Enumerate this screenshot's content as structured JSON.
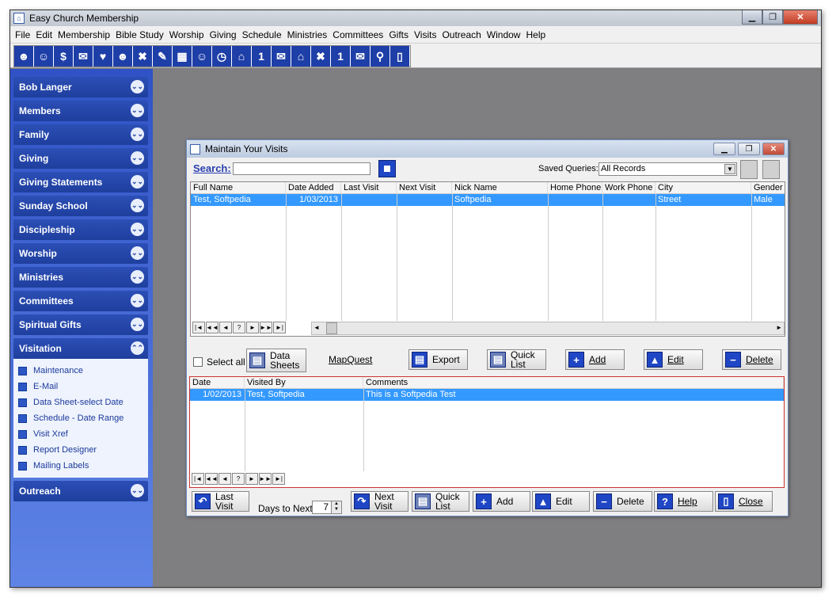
{
  "app": {
    "title": "Easy Church Membership"
  },
  "menu": [
    "File",
    "Edit",
    "Membership",
    "Bible Study",
    "Worship",
    "Giving",
    "Schedule",
    "Ministries",
    "Committees",
    "Gifts",
    "Visits",
    "Outreach",
    "Window",
    "Help"
  ],
  "toolbar_icons": [
    "people-icon",
    "person-icon",
    "dollar-icon",
    "envelope-icon",
    "heart-icon",
    "group-icon",
    "tools-icon",
    "pen-icon",
    "calendar-icon",
    "person-calendar-icon",
    "clock-calendar-icon",
    "house-icon",
    "number-one-icon",
    "envelope-person-icon",
    "church-icon",
    "tools2-icon",
    "number-one2-icon",
    "envelope-person2-icon",
    "search-envelope-icon",
    "exit-icon"
  ],
  "sidebar": {
    "items": [
      "Bob Langer",
      "Members",
      "Family",
      "Giving",
      "Giving Statements",
      "Sunday School",
      "Discipleship",
      "Worship",
      "Ministries",
      "Committees",
      "Spiritual Gifts",
      "Visitation"
    ],
    "sub": [
      "Maintenance",
      "E-Mail",
      "Data Sheet-select Date",
      "Schedule - Date Range",
      "Visit Xref",
      "Report Designer",
      "Mailing Labels"
    ],
    "bottom": "Outreach"
  },
  "window": {
    "title": "Maintain Your Visits",
    "search_label": "Search:",
    "saved_queries_label": "Saved Queries:",
    "saved_queries_value": "All Records"
  },
  "grid1": {
    "headers": [
      "Full Name",
      "Date Added",
      "Last Visit",
      "Next Visit",
      "Nick Name",
      "Home Phone",
      "Work Phone",
      "City",
      "Gender"
    ],
    "row": [
      "Test, Softpedia",
      "1/03/2013",
      "",
      "",
      "Softpedia",
      "",
      "",
      "Street",
      "Male"
    ]
  },
  "mid": {
    "select_all": "Select all",
    "data_sheets": "Data\nSheets",
    "mapquest": "MapQuest",
    "export": "Export",
    "quick_list": "Quick\nList",
    "add": "Add",
    "edit": "Edit",
    "delete": "Delete"
  },
  "grid2": {
    "headers": [
      "Date",
      "Visited By",
      "Comments"
    ],
    "row": [
      "1/02/2013",
      "Test, Softpedia",
      "This is a Softpedia Test"
    ]
  },
  "bottom": {
    "last_visit": "Last\nVisit",
    "days_to_next": "Days to Next:",
    "days_value": "7",
    "next_visit": "Next\nVisit",
    "quick_list": "Quick\nList",
    "add": "Add",
    "edit": "Edit",
    "delete": "Delete",
    "help": "Help",
    "close": "Close"
  },
  "nav": [
    "|◄",
    "◄◄",
    "◄",
    "?",
    "►",
    "►►",
    "►|"
  ]
}
